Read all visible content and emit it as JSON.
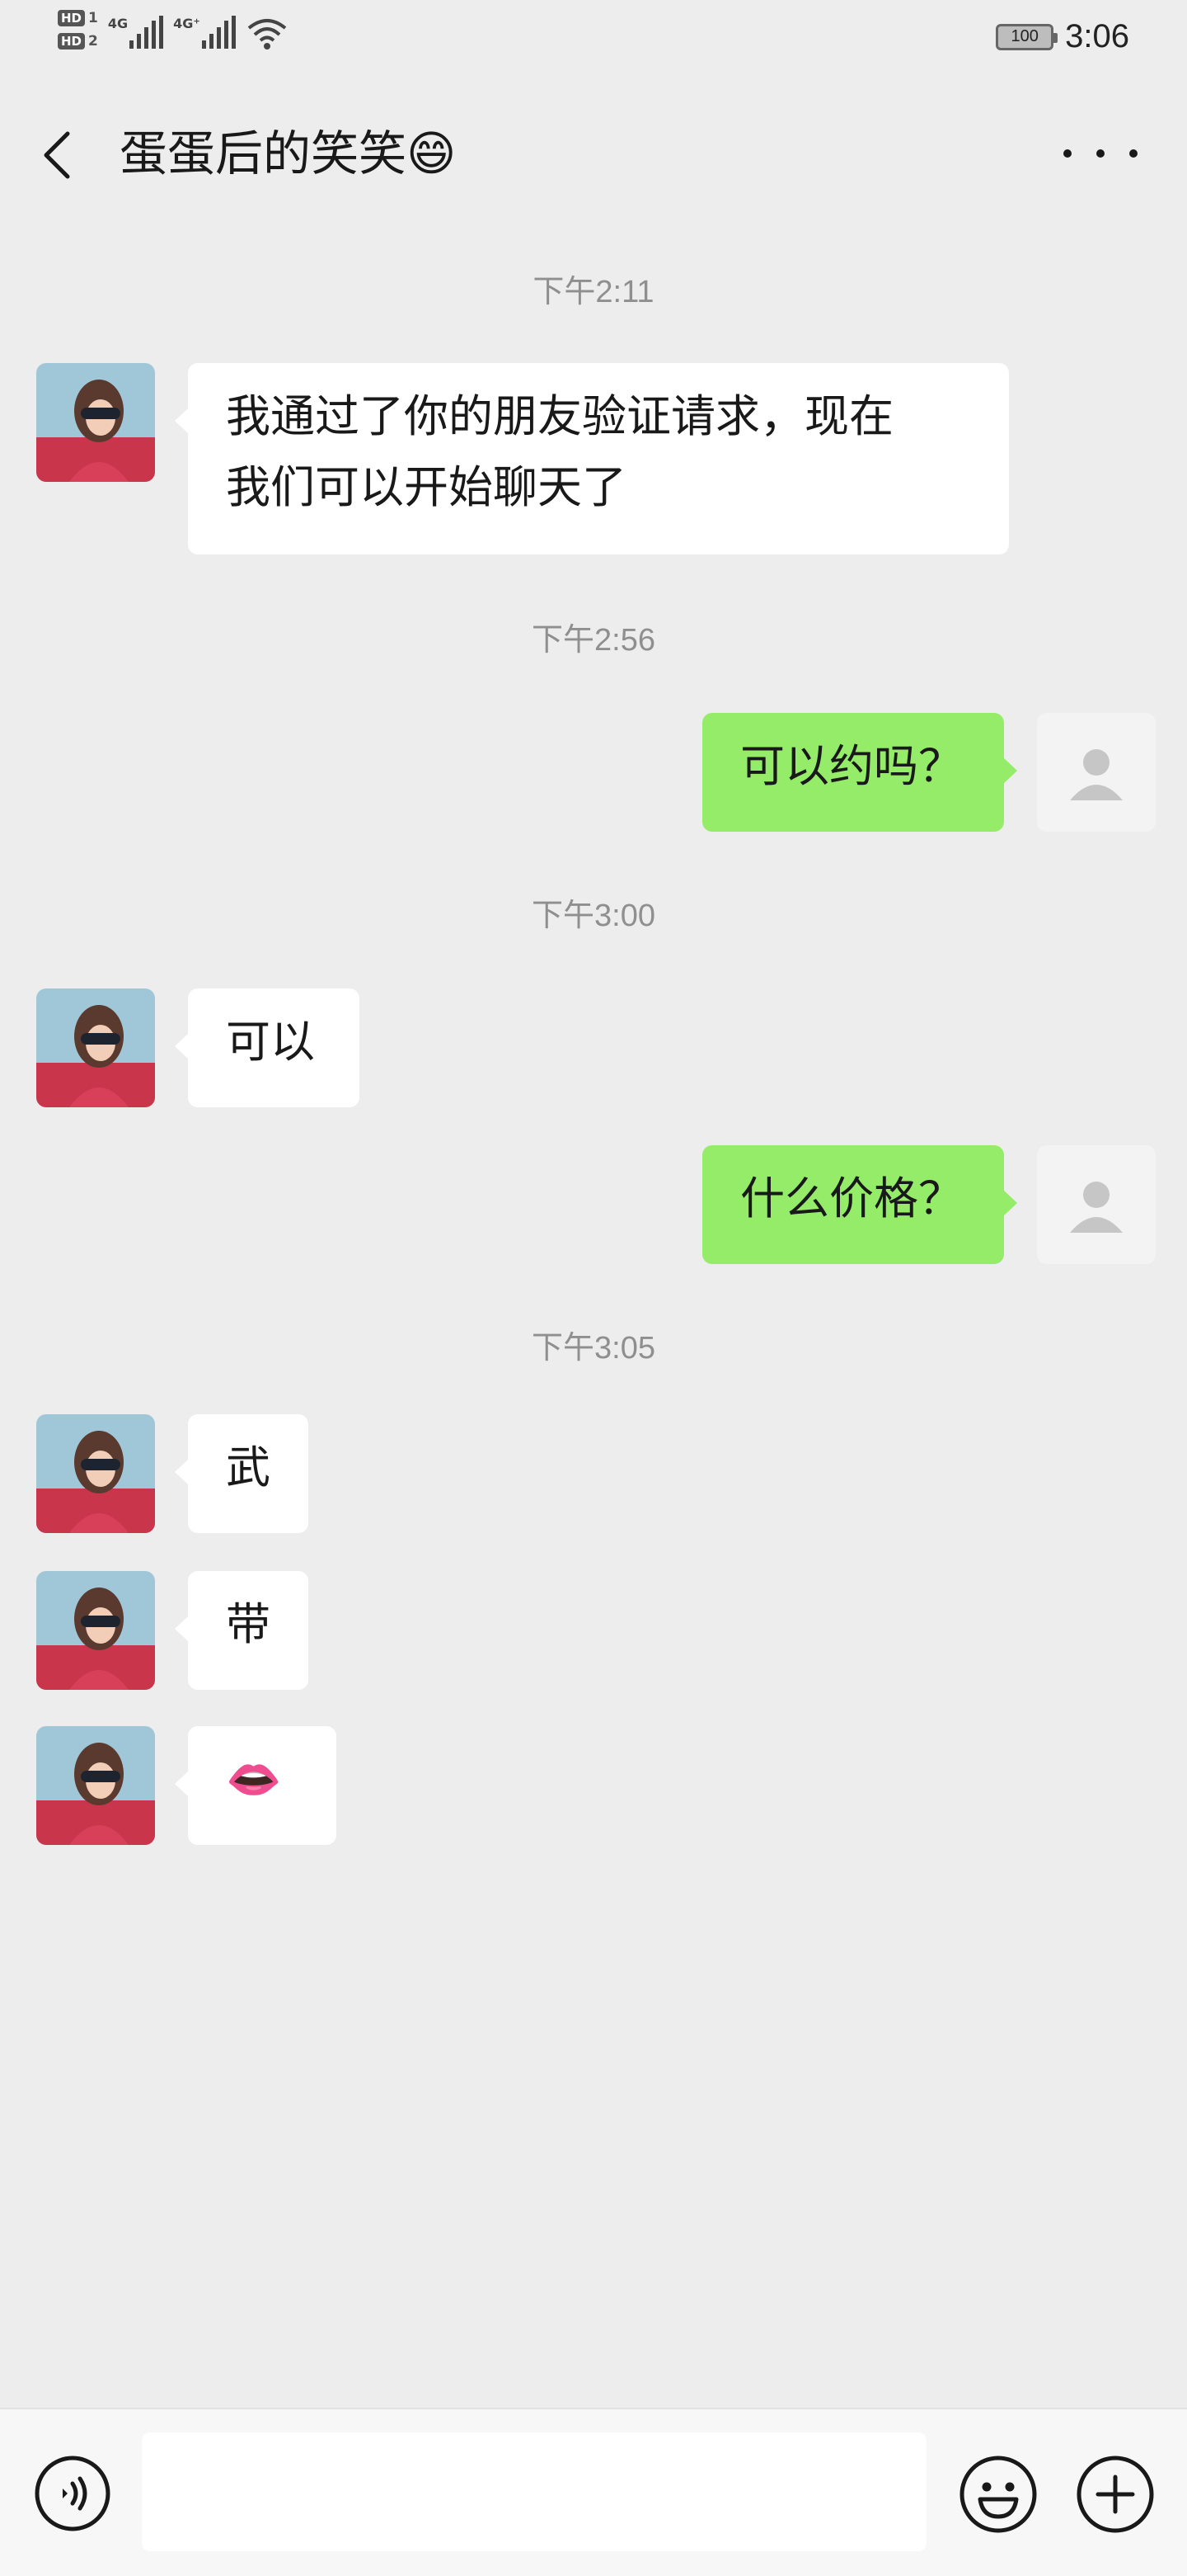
{
  "status_bar": {
    "hd1": "HD",
    "hd1_sub": "1",
    "hd2": "HD",
    "hd2_sub": "2",
    "net1": "4G",
    "net2": "4G⁺",
    "battery": "100",
    "time": "3:06"
  },
  "header": {
    "title": "蛋蛋后的笑笑😄"
  },
  "timestamps": [
    "下午2:11",
    "下午2:56",
    "下午3:00",
    "下午3:05"
  ],
  "messages": [
    {
      "side": "in",
      "lines": [
        "我通过了你的朋友验证请求，现在",
        "我们可以开始聊天了"
      ]
    },
    {
      "side": "out",
      "text": "可以约吗？"
    },
    {
      "side": "in",
      "text": "可以"
    },
    {
      "side": "out",
      "text": "什么价格？"
    },
    {
      "side": "in",
      "text": "武"
    },
    {
      "side": "in",
      "text": "带"
    },
    {
      "side": "in",
      "text": "👄"
    }
  ],
  "input_bar": {
    "placeholder": "",
    "icons": [
      "voice-icon",
      "emoji-icon",
      "plus-icon"
    ]
  },
  "colors": {
    "background": "#ededed",
    "incoming_bubble": "#ffffff",
    "outgoing_bubble": "#95ec69",
    "timestamp": "#8f8f8f"
  }
}
